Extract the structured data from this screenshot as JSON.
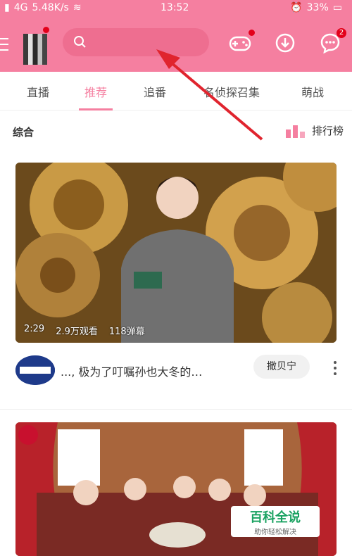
{
  "status_bar": {
    "signal": "4G",
    "speed": "5.48K/s",
    "time": "13:52",
    "battery": "33%"
  },
  "header": {
    "search": {
      "placeholder": ""
    },
    "message_badge": "2",
    "colors": {
      "header": "#f57fa0",
      "badge": "#e3001a"
    }
  },
  "tabs": [
    {
      "label": "直播"
    },
    {
      "label": "推荐"
    },
    {
      "label": "追番"
    },
    {
      "label": "名侦探召集"
    },
    {
      "label": "萌战"
    }
  ],
  "section": {
    "title": "综合",
    "rank_label": "排行榜"
  },
  "video1": {
    "duration": "2:29",
    "views": "2.9万观看",
    "danmaku": "118弹幕",
    "title": "..., 极为了叮嘱孙也大冬的…",
    "follow_label": "撒贝宁"
  },
  "watermark": {
    "title": "百科全说",
    "subtitle": "助你轻松解决"
  }
}
